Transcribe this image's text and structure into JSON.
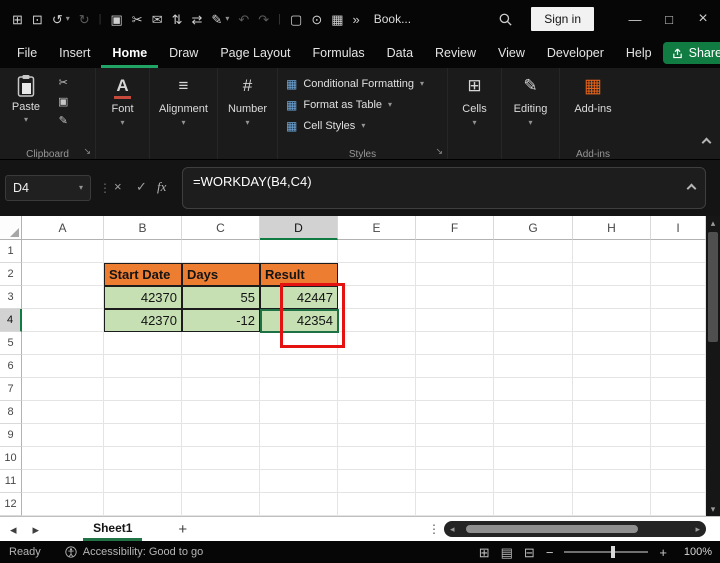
{
  "icons": {
    "caret_down": "▾",
    "dialog_launcher": "↘",
    "vertical_dots": "⋮",
    "cancel": "×",
    "enter": "✓",
    "fx": "fx",
    "tab_scroll_left": "◂",
    "tab_scroll_right": "▸",
    "add_sheet": "+",
    "scroll_left": "◂",
    "scroll_right": "▸",
    "scroll_up": "▴",
    "scroll_down": "▾",
    "view_normal": "⊞",
    "view_page_layout": "▤",
    "view_page_break": "⊟",
    "zoom_out": "−",
    "zoom_in": "+",
    "font": "A",
    "alignment": "≡",
    "number": "#",
    "cells": "⊞",
    "editing": "✎",
    "addins": "▦",
    "styles_item": "▦",
    "cut": "✂",
    "copy": "▣",
    "format_painter": "✎",
    "minimize": "—",
    "maximize": "□",
    "close": "×"
  },
  "titlebar": {
    "quick_access_icons": [
      {
        "name": "apps-icon",
        "glyph": "⊞"
      },
      {
        "name": "save-icon",
        "glyph": "⊡"
      },
      {
        "name": "undo-icon",
        "glyph": "↺"
      },
      {
        "name": "undo-dropdown-icon",
        "glyph": "▾",
        "small": true
      },
      {
        "name": "redo-icon",
        "glyph": "↻",
        "dim": true
      },
      {
        "name": "qat-separator",
        "glyph": "|",
        "sep": true
      },
      {
        "name": "copy-icon",
        "glyph": "▣"
      },
      {
        "name": "cut-icon",
        "glyph": "✂"
      },
      {
        "name": "mail-icon",
        "glyph": "✉"
      },
      {
        "name": "sort-ascending-icon",
        "glyph": "⇅"
      },
      {
        "name": "sort-descending-icon",
        "glyph": "⇄"
      },
      {
        "name": "format-painter-icon",
        "glyph": "✎"
      },
      {
        "name": "painter-dropdown-icon",
        "glyph": "▾",
        "small": true
      },
      {
        "name": "undo-alt-icon",
        "glyph": "↶",
        "dim": true
      },
      {
        "name": "redo-alt-icon",
        "glyph": "↷",
        "dim": true
      },
      {
        "name": "qat-separator",
        "glyph": "|",
        "sep": true
      },
      {
        "name": "new-document-icon",
        "glyph": "▢"
      },
      {
        "name": "camera-icon",
        "glyph": "⊙"
      },
      {
        "name": "keyboard-icon",
        "glyph": "▦"
      },
      {
        "name": "overflow-icon",
        "glyph": "»"
      }
    ],
    "document_title": "Book...",
    "sign_in_label": "Sign in"
  },
  "menubar": {
    "items": [
      {
        "label": "File"
      },
      {
        "label": "Insert"
      },
      {
        "label": "Home",
        "active": true
      },
      {
        "label": "Draw"
      },
      {
        "label": "Page Layout"
      },
      {
        "label": "Formulas"
      },
      {
        "label": "Data"
      },
      {
        "label": "Review"
      },
      {
        "label": "View"
      },
      {
        "label": "Developer"
      },
      {
        "label": "Help"
      }
    ],
    "share_label": "Share"
  },
  "ribbon": {
    "paste_label": "Paste",
    "clipboard_group_label": "Clipboard",
    "font_label": "Font",
    "alignment_label": "Alignment",
    "number_label": "Number",
    "styles": {
      "items": [
        "Conditional Formatting",
        "Format as Table",
        "Cell Styles"
      ],
      "group_label": "Styles"
    },
    "cells_label": "Cells",
    "editing_label": "Editing",
    "addins_label": "Add-ins",
    "addins_group_label": "Add-ins"
  },
  "formula_bar": {
    "name_box_value": "D4",
    "formula": "=WORKDAY(B4,C4)"
  },
  "grid": {
    "column_headers": [
      "A",
      "B",
      "C",
      "D",
      "E",
      "F",
      "G",
      "H",
      "I"
    ],
    "row_headers": [
      "1",
      "2",
      "3",
      "4",
      "5",
      "6",
      "7",
      "8",
      "9",
      "10",
      "11",
      "12"
    ],
    "active_column": "D",
    "active_row": "4",
    "active_cell": "D4",
    "cells": {
      "B2": "Start Date",
      "C2": "Days",
      "D2": "Result",
      "B3": "42370",
      "C3": "55",
      "D3": "42447",
      "B4": "42370",
      "C4": "-12",
      "D4": "42354"
    },
    "styles": {
      "orange_cells": [
        "B2",
        "C2",
        "D2"
      ],
      "green_cells": [
        "B3",
        "C3",
        "D3",
        "B4",
        "C4",
        "D4"
      ],
      "orange_fill": "#ED7D31",
      "green_fill": "#C6E0B4",
      "annotation_color": "#E51212",
      "selection_color": "#1E7145"
    }
  },
  "sheet_bar": {
    "tabs": [
      {
        "label": "Sheet1",
        "active": true
      }
    ]
  },
  "status_bar": {
    "mode": "Ready",
    "accessibility_text": "Accessibility: Good to go",
    "zoom_level": "100%"
  }
}
